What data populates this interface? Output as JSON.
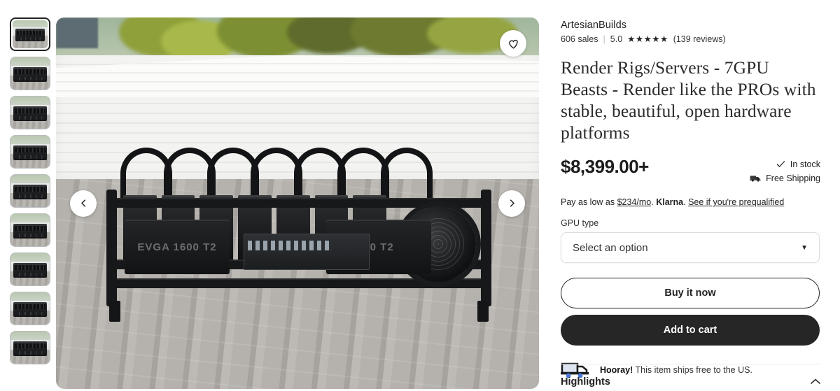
{
  "gallery": {
    "prev_icon": "chevron-left-icon",
    "next_icon": "chevron-right-icon",
    "favorite_icon": "heart-icon",
    "thumbnail_count": 9,
    "selected_thumbnail": 1,
    "psu_left_label": "EVGA 1600 T2",
    "psu_right_label": "10 T2"
  },
  "shop": {
    "name": "ArtesianBuilds",
    "sales": "606 sales",
    "separator": "|",
    "rating": "5.0",
    "stars": "★★★★★",
    "reviews": "(139 reviews)"
  },
  "product": {
    "title": "Render Rigs/Servers - 7GPU Beasts - Render like the PROs with stable, beautiful, open hardware platforms",
    "price": "$8,399.00+",
    "in_stock": "In stock",
    "in_stock_icon": "checkmark-icon",
    "free_shipping": "Free Shipping",
    "free_shipping_icon": "delivery-truck-icon"
  },
  "financing": {
    "prefix": "Pay as low as ",
    "amount": "$234/mo",
    "middle": ". ",
    "provider": "Klarna",
    "dot": ". ",
    "link": "See if you're prequalified"
  },
  "options": {
    "gpu_type_label": "GPU type",
    "gpu_type_value": "Select an option",
    "caret_icon": "chevron-down-icon"
  },
  "actions": {
    "buy_now": "Buy it now",
    "add_to_cart": "Add to cart"
  },
  "shipping_note": {
    "highlight": "Hooray!",
    "text": " This item ships free to the US."
  },
  "highlights": {
    "label": "Highlights",
    "chevron_icon": "chevron-up-icon",
    "chevron": "︿"
  },
  "colors": {
    "dark": "#262626",
    "text": "#222222",
    "truck_body": "#dde4f0",
    "truck_wheel": "#4a78d8"
  }
}
